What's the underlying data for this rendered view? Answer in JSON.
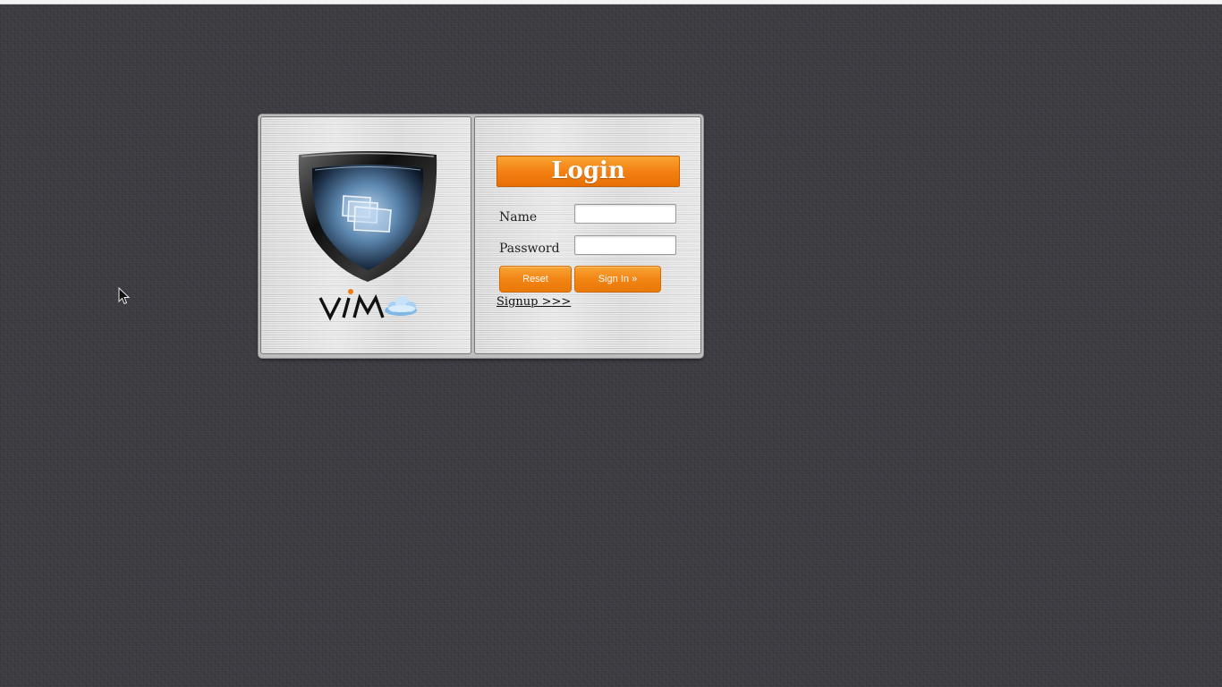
{
  "brand": {
    "logo_text": "VIM",
    "logo_icon": "cloud-icon",
    "emblem": "shield-icon"
  },
  "login": {
    "title": "Login",
    "fields": {
      "name_label": "Name",
      "name_value": "",
      "password_label": "Password",
      "password_value": ""
    },
    "buttons": {
      "reset_label": "Reset",
      "signin_label": "Sign In »"
    },
    "signup_label": "Signup >>>"
  },
  "colors": {
    "accent_orange": "#f28514",
    "background": "#3b3b41",
    "panel": "#d6d6d6"
  }
}
